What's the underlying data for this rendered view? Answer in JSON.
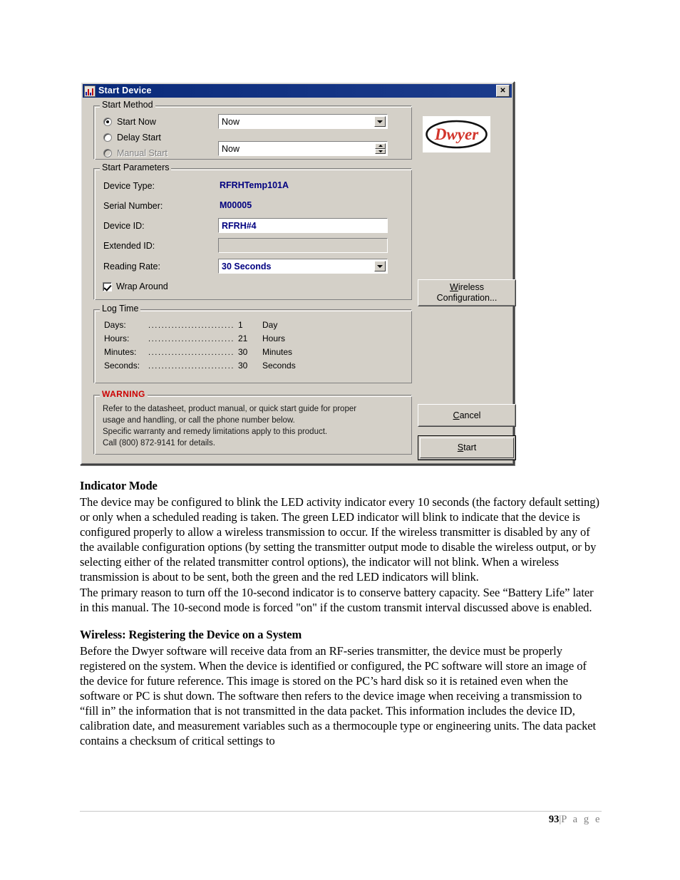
{
  "dialog": {
    "title": "Start Device",
    "close_label": "✕",
    "start_method": {
      "group_label": "Start Method",
      "options": [
        {
          "label": "Start Now",
          "checked": true,
          "disabled": false
        },
        {
          "label": "Delay Start",
          "checked": false,
          "disabled": false
        },
        {
          "label": "Manual Start",
          "checked": false,
          "disabled": true
        }
      ],
      "start_now_combo_value": "Now",
      "delay_start_value": "Now"
    },
    "start_parameters": {
      "group_label": "Start Parameters",
      "device_type_label": "Device Type:",
      "device_type_value": "RFRHTemp101A",
      "serial_number_label": "Serial Number:",
      "serial_number_value": "M00005",
      "device_id_label": "Device ID:",
      "device_id_value": "RFRH#4",
      "extended_id_label": "Extended ID:",
      "extended_id_value": "",
      "reading_rate_label": "Reading Rate:",
      "reading_rate_value": "30 Seconds",
      "wrap_around_label": "Wrap Around",
      "wrap_around_checked": true
    },
    "log_time": {
      "group_label": "Log Time",
      "rows": [
        {
          "name": "Days:",
          "dots": "...................................",
          "value": "1",
          "unit": "Day"
        },
        {
          "name": "Hours:",
          "dots": "...................................",
          "value": "21",
          "unit": "Hours"
        },
        {
          "name": "Minutes:",
          "dots": "...............................",
          "value": "30",
          "unit": "Minutes"
        },
        {
          "name": "Seconds:",
          "dots": "..............................",
          "value": "30",
          "unit": "Seconds"
        }
      ]
    },
    "warning": {
      "group_label": "WARNING",
      "lines": [
        "Refer to the datasheet, product manual, or quick start guide for proper",
        "usage and handling, or call the phone number below.",
        "Specific warranty and remedy limitations apply to this product.",
        "Call (800) 872-9141 for details."
      ]
    },
    "buttons": {
      "wireless_configuration_line1": "Wireless",
      "wireless_configuration_line2": "Configuration...",
      "cancel": "Cancel",
      "start": "Start"
    },
    "logo": {
      "text": "Dwyer",
      "brand_color": "#d2352c"
    },
    "colors": {
      "titlebar": "#0a2a7a",
      "face": "#d4d0c8",
      "value_blue": "#000080",
      "warning_red": "#cc0000"
    }
  },
  "document": {
    "section1": {
      "heading": "Indicator Mode",
      "paragraph1": "The device may be configured to blink the LED activity indicator every 10 seconds (the factory default setting) or only when a scheduled reading is taken. The green LED indicator will blink to indicate that the device is configured properly to allow a wireless transmission to occur. If the wireless transmitter is disabled by any of the available configuration options (by setting the transmitter output mode to disable the wireless output, or by selecting either of the related transmitter control options), the indicator will not blink. When a wireless transmission is about to be sent, both the green and the red LED indicators will blink.",
      "paragraph2": "The primary reason to turn off the 10-second indicator is to conserve battery capacity. See “Battery Life” later in this manual. The 10-second mode is forced \"on\" if the custom transmit interval discussed above is enabled."
    },
    "section2": {
      "heading": "Wireless: Registering the Device on a System",
      "paragraph1": "Before the Dwyer software will receive data from an RF-series transmitter, the device must be properly registered on the system. When the device is identified or configured, the PC software will store an image of the device for future reference. This image is stored on the PC’s hard disk so it is retained even when the software or PC is shut down. The software then refers to the device image when receiving a transmission to “fill in” the information that is not transmitted in the data packet. This information includes the device ID, calibration date, and measurement variables such as a thermocouple type or engineering units. The data packet contains a checksum of critical settings to"
    },
    "footer": {
      "page_number": "93",
      "separator": "|",
      "page_word": "P a g e"
    }
  }
}
